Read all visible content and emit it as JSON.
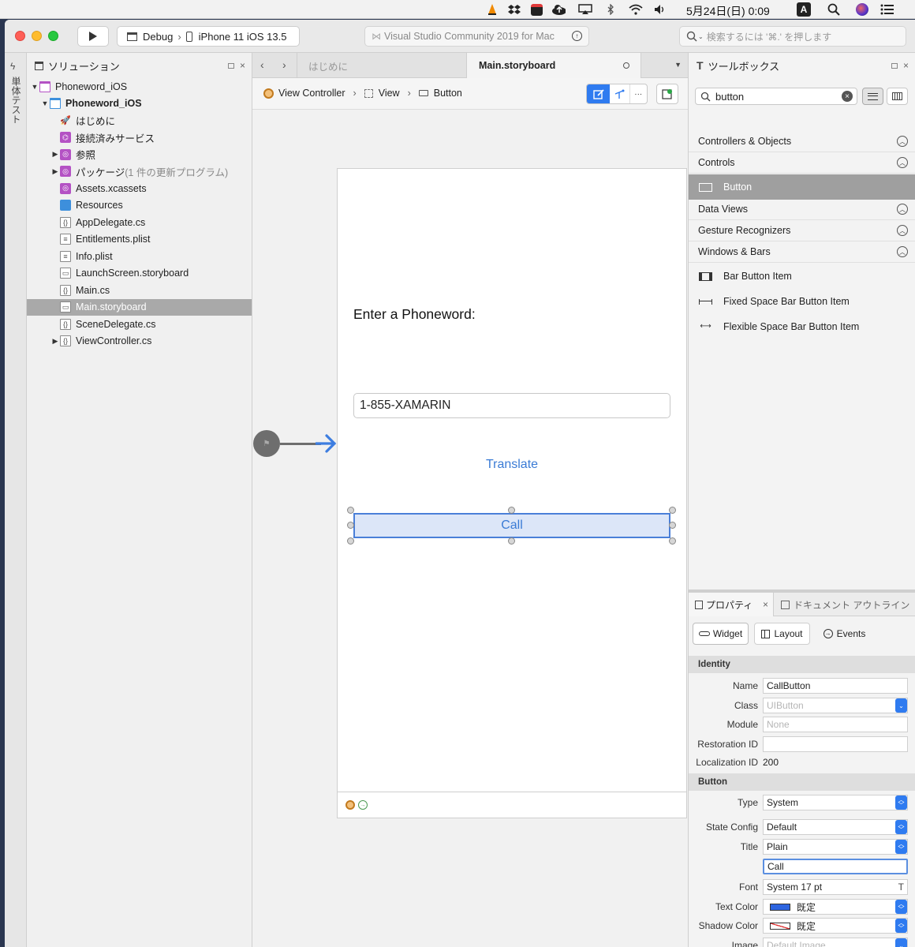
{
  "menubar": {
    "clock": "5月24日(日)  0:09",
    "input_indicator": "A"
  },
  "toolbar": {
    "config": "Debug",
    "device": "iPhone 11 iOS 13.5",
    "app_title": "Visual Studio Community 2019 for Mac",
    "search_placeholder": "検索するには '⌘.' を押します"
  },
  "left_strip": {
    "label": "単体テスト"
  },
  "solution": {
    "title": "ソリューション",
    "items": [
      {
        "label": "Phoneword_iOS",
        "bold": false,
        "indent": 0,
        "disclosure": "▼",
        "icon": "solution-icon",
        "selected": false
      },
      {
        "label": "Phoneword_iOS",
        "bold": true,
        "indent": 1,
        "disclosure": "▼",
        "icon": "project-icon",
        "selected": false
      },
      {
        "label": "はじめに",
        "bold": false,
        "indent": 2,
        "disclosure": "",
        "icon": "rocket-icon",
        "selected": false
      },
      {
        "label": "接続済みサービス",
        "bold": false,
        "indent": 2,
        "disclosure": "",
        "icon": "services-icon",
        "selected": false
      },
      {
        "label": "参照",
        "bold": false,
        "indent": 2,
        "disclosure": "▶",
        "icon": "references-icon",
        "selected": false
      },
      {
        "label": "パッケージ",
        "suffix": " (1 件の更新プログラム)",
        "bold": false,
        "indent": 2,
        "disclosure": "▶",
        "icon": "packages-icon",
        "selected": false
      },
      {
        "label": "Assets.xcassets",
        "bold": false,
        "indent": 2,
        "disclosure": "",
        "icon": "assets-icon",
        "selected": false
      },
      {
        "label": "Resources",
        "bold": false,
        "indent": 2,
        "disclosure": "",
        "icon": "folder-icon",
        "selected": false
      },
      {
        "label": "AppDelegate.cs",
        "bold": false,
        "indent": 2,
        "disclosure": "",
        "icon": "cs-file-icon",
        "selected": false
      },
      {
        "label": "Entitlements.plist",
        "bold": false,
        "indent": 2,
        "disclosure": "",
        "icon": "plist-file-icon",
        "selected": false
      },
      {
        "label": "Info.plist",
        "bold": false,
        "indent": 2,
        "disclosure": "",
        "icon": "plist-file-icon",
        "selected": false
      },
      {
        "label": "LaunchScreen.storyboard",
        "bold": false,
        "indent": 2,
        "disclosure": "",
        "icon": "storyboard-file-icon",
        "selected": false
      },
      {
        "label": "Main.cs",
        "bold": false,
        "indent": 2,
        "disclosure": "",
        "icon": "cs-file-icon",
        "selected": false
      },
      {
        "label": "Main.storyboard",
        "bold": false,
        "indent": 2,
        "disclosure": "",
        "icon": "storyboard-file-icon",
        "selected": true
      },
      {
        "label": "SceneDelegate.cs",
        "bold": false,
        "indent": 2,
        "disclosure": "",
        "icon": "cs-file-icon",
        "selected": false
      },
      {
        "label": "ViewController.cs",
        "bold": false,
        "indent": 2,
        "disclosure": "▶",
        "icon": "cs-file-icon",
        "selected": false
      }
    ]
  },
  "editor": {
    "tabs": [
      {
        "label": "はじめに",
        "active": false
      },
      {
        "label": "Main.storyboard",
        "active": true
      }
    ],
    "breadcrumb": [
      "View Controller",
      "View",
      "Button"
    ],
    "scene": {
      "label_text": "Enter a Phoneword:",
      "textfield_value": "1-855-XAMARIN",
      "translate_title": "Translate",
      "call_title": "Call"
    }
  },
  "toolbox": {
    "title": "ツールボックス",
    "search_value": "button",
    "categories_top": [
      "Controllers & Objects",
      "Controls"
    ],
    "selected_item": "Button",
    "categories_bottom": [
      "Data Views",
      "Gesture Recognizers",
      "Windows & Bars"
    ],
    "items": [
      {
        "label": "Bar Button Item",
        "icon": "bar-button-item-icon"
      },
      {
        "label": "Fixed Space Bar Button Item",
        "icon": "fixed-space-icon"
      },
      {
        "label": "Flexible Space Bar Button Item",
        "icon": "flexible-space-icon"
      }
    ]
  },
  "properties": {
    "tab_props": "プロパティ",
    "tab_outline": "ドキュメント アウトライン",
    "buttons": [
      "Widget",
      "Layout",
      "Events"
    ],
    "identity_header": "Identity",
    "identity": {
      "name_label": "Name",
      "name_value": "CallButton",
      "class_label": "Class",
      "class_placeholder": "UIButton",
      "module_label": "Module",
      "module_placeholder": "None",
      "restoration_label": "Restoration ID",
      "restoration_value": "",
      "localization_label": "Localization ID",
      "localization_value": "200"
    },
    "button_header": "Button",
    "button": {
      "type_label": "Type",
      "type_value": "System",
      "state_label": "State Config",
      "state_value": "Default",
      "title_label": "Title",
      "title_value": "Plain",
      "title_text": "Call",
      "font_label": "Font",
      "font_value": "System 17 pt",
      "textcolor_label": "Text Color",
      "textcolor_value": "既定",
      "shadow_label": "Shadow Color",
      "shadow_value": "既定",
      "image_label": "Image",
      "image_placeholder": "Default Image"
    }
  },
  "colors": {
    "accent": "#2f7bf0",
    "link": "#3a7bd5",
    "selection_gray": "#a9a9a9"
  }
}
